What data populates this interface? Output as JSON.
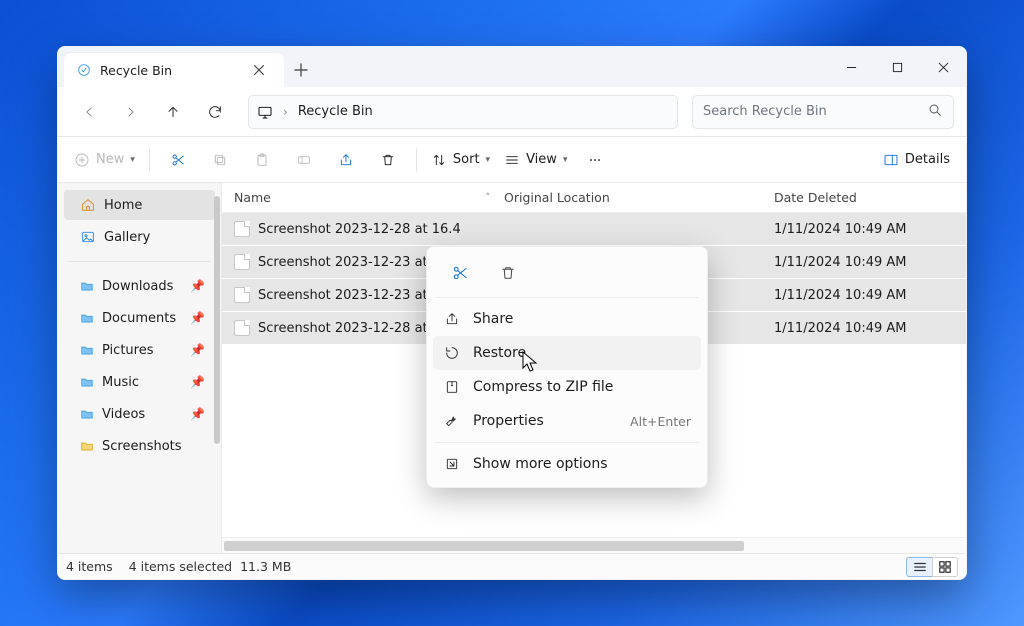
{
  "window": {
    "tab_title": "Recycle Bin",
    "address": {
      "location": "Recycle Bin"
    },
    "search_placeholder": "Search Recycle Bin"
  },
  "toolbar": {
    "new_label": "New",
    "sort_label": "Sort",
    "view_label": "View",
    "details_label": "Details"
  },
  "sidebar": {
    "items": [
      {
        "label": "Home",
        "icon": "home",
        "active": true
      },
      {
        "label": "Gallery",
        "icon": "gallery"
      }
    ],
    "pinned": [
      {
        "label": "Downloads"
      },
      {
        "label": "Documents"
      },
      {
        "label": "Pictures"
      },
      {
        "label": "Music"
      },
      {
        "label": "Videos"
      },
      {
        "label": "Screenshots",
        "folder_color": "#f7c948"
      }
    ]
  },
  "columns": {
    "name": "Name",
    "original": "Original Location",
    "deleted": "Date Deleted"
  },
  "rows": [
    {
      "name": "Screenshot 2023-12-28 at 16.4",
      "date": "1/11/2024 10:49 AM"
    },
    {
      "name": "Screenshot 2023-12-23 at 14.5",
      "date": "1/11/2024 10:49 AM"
    },
    {
      "name": "Screenshot 2023-12-23 at 14.5",
      "date": "1/11/2024 10:49 AM"
    },
    {
      "name": "Screenshot 2023-12-28 at 09.3",
      "date": "1/11/2024 10:49 AM"
    }
  ],
  "context_menu": {
    "share": "Share",
    "restore": "Restore",
    "compress": "Compress to ZIP file",
    "properties": "Properties",
    "properties_shortcut": "Alt+Enter",
    "more": "Show more options"
  },
  "status": {
    "count": "4 items",
    "selected": "4 items selected",
    "size": "11.3 MB"
  }
}
